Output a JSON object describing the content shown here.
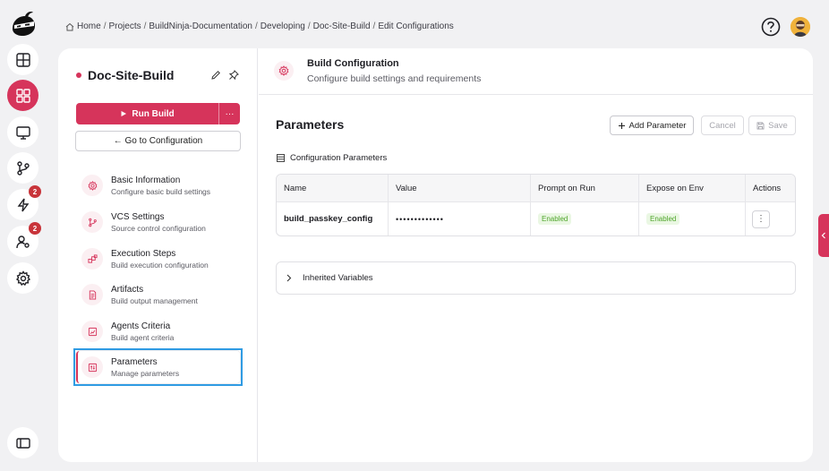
{
  "breadcrumb": [
    "Home",
    "Projects",
    "BuildNinja-Documentation",
    "Developing",
    "Doc-Site-Build",
    "Edit Configurations"
  ],
  "rail": {
    "badges": {
      "lightning": "2",
      "users": "2"
    }
  },
  "project": {
    "title": "Doc-Site-Build",
    "run_label": "Run Build",
    "more_label": "···",
    "goto_label": "← Go to Configuration"
  },
  "nav": [
    {
      "title": "Basic Information",
      "sub": "Configure basic build settings",
      "icon": "gear-icon"
    },
    {
      "title": "VCS Settings",
      "sub": "Source control configuration",
      "icon": "branch-icon"
    },
    {
      "title": "Execution Steps",
      "sub": "Build execution configuration",
      "icon": "steps-icon"
    },
    {
      "title": "Artifacts",
      "sub": "Build output management",
      "icon": "file-icon"
    },
    {
      "title": "Agents Criteria",
      "sub": "Build agent criteria",
      "icon": "agent-icon"
    },
    {
      "title": "Parameters",
      "sub": "Manage parameters",
      "icon": "parameters-icon"
    }
  ],
  "header": {
    "title": "Build Configuration",
    "subtitle": "Configure build settings and requirements"
  },
  "parameters": {
    "title": "Parameters",
    "add_label": "Add Parameter",
    "cancel_label": "Cancel",
    "save_label": "Save",
    "section_label": "Configuration Parameters",
    "columns": [
      "Name",
      "Value",
      "Prompt on Run",
      "Expose on Env",
      "Actions"
    ],
    "rows": [
      {
        "name": "build_passkey_config",
        "value": "•••••••••••••",
        "prompt": "Enabled",
        "expose": "Enabled"
      }
    ],
    "inherited_label": "Inherited Variables"
  },
  "colors": {
    "accent": "#d6345b",
    "selection": "#2f9be3",
    "enabled": "#4fa52b"
  }
}
